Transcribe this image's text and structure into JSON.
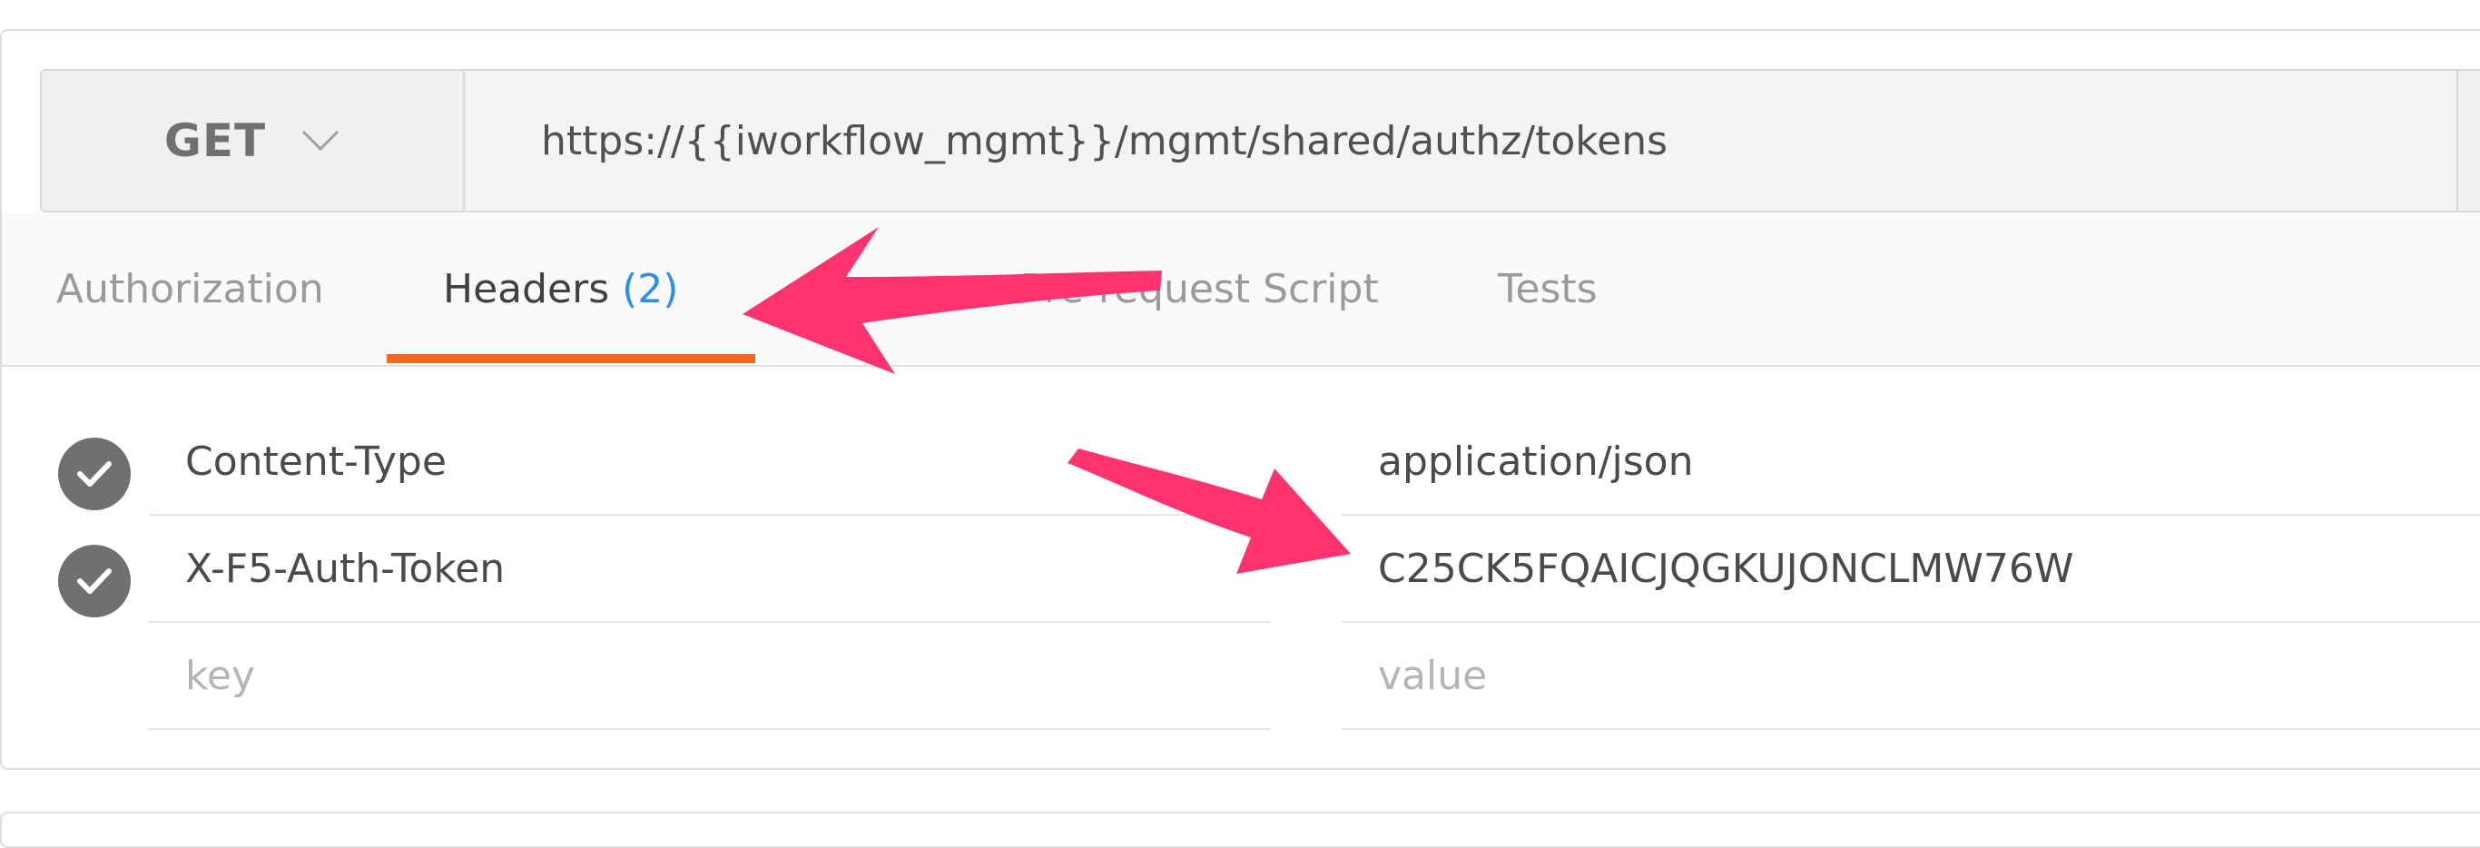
{
  "request": {
    "method": "GET",
    "url": "https://{{iworkflow_mgmt}}/mgmt/shared/authz/tokens"
  },
  "tabs": [
    {
      "label": "Authorization",
      "active": false
    },
    {
      "label": "Headers",
      "count": "(2)",
      "active": true
    },
    {
      "label": "Pre-request Script",
      "active": false
    },
    {
      "label": "Tests",
      "active": false
    }
  ],
  "headers": [
    {
      "key": "Content-Type",
      "value": "application/json",
      "enabled": true
    },
    {
      "key": "X-F5-Auth-Token",
      "value": "C25CK5FQAICJQGKUJONCLMW76W",
      "enabled": true
    }
  ],
  "new_header": {
    "key_placeholder": "key",
    "value_placeholder": "value"
  },
  "colors": {
    "accent_underline": "#f26b1d",
    "count_blue": "#2f8ee8",
    "annotation_arrow": "#ff3370",
    "checkbox_gray": "#707070"
  },
  "icons": {
    "method_dropdown": "chevron-down-icon",
    "header_enabled": "checkmark-circle-icon"
  }
}
